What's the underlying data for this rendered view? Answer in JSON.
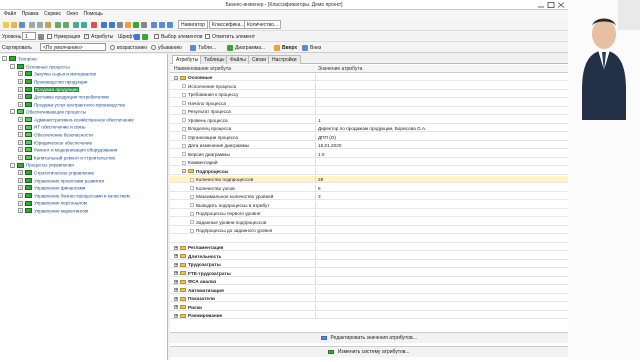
{
  "window": {
    "title": "Бизнес-инженер - [Классификаторы. Демо проект]"
  },
  "menu": [
    "Файл",
    "Правка",
    "Сервис",
    "Окно",
    "Помощь"
  ],
  "toolbar_tabs": [
    "Навигатор",
    "Классифика...",
    "Количество..."
  ],
  "toolbar2": {
    "level_label": "Уровень",
    "level_value": "1",
    "numbering": "Нумерация",
    "attributes": "Атрибуты",
    "font": "Шрифт",
    "select_elements": "Выбор элементов",
    "mark_element": "Отметить элемент"
  },
  "toolbar3": {
    "sort_label": "Сортировать",
    "sort_value": "<По умолчанию>",
    "asc": "возрастанию",
    "desc": "убыванию",
    "table": "Табли...",
    "diagram": "Диаграмма...",
    "up": "Вверх",
    "down": "Вниз"
  },
  "tree": [
    {
      "text": "Техпрокс",
      "level": 0,
      "expand": "-",
      "color": "#3a3"
    },
    {
      "text": "Основные процессы",
      "level": 1,
      "expand": "-",
      "color": "#3a3"
    },
    {
      "text": "Закупка сырья и материалов",
      "level": 2,
      "expand": "+",
      "color": "#3a3"
    },
    {
      "text": "Производство продукции",
      "level": 2,
      "expand": "+",
      "color": "#3a3"
    },
    {
      "text": "Продажа продукции",
      "level": 2,
      "expand": "+",
      "color": "#3a3",
      "selected": true
    },
    {
      "text": "Доставка продукции потребителям",
      "level": 2,
      "expand": "+",
      "color": "#3a3"
    },
    {
      "text": "Продажа услуг контрактного производства",
      "level": 2,
      "expand": "+",
      "color": "#3a3"
    },
    {
      "text": "Обеспечивающие процессы",
      "level": 1,
      "expand": "-",
      "color": "#5c5"
    },
    {
      "text": "Административно-хозяйственное обеспечение",
      "level": 2,
      "expand": "+",
      "color": "#5c5"
    },
    {
      "text": "ИТ обеспечение и связь",
      "level": 2,
      "expand": "+",
      "color": "#5c5"
    },
    {
      "text": "Обеспечение безопасности",
      "level": 2,
      "expand": "+",
      "color": "#5c5"
    },
    {
      "text": "Юридическое обеспечение",
      "level": 2,
      "expand": "+",
      "color": "#5c5"
    },
    {
      "text": "Ремонт и модернизация оборудования",
      "level": 2,
      "expand": "+",
      "color": "#5c5"
    },
    {
      "text": "Капитальный ремонт и строительство",
      "level": 2,
      "expand": "+",
      "color": "#5c5"
    },
    {
      "text": "Процессы управления",
      "level": 1,
      "expand": "-",
      "color": "#3a3"
    },
    {
      "text": "Стратегическое управление",
      "level": 2,
      "expand": "+",
      "color": "#3a3"
    },
    {
      "text": "Управление проектами развития",
      "level": 2,
      "expand": "+",
      "color": "#3a3"
    },
    {
      "text": "Управление финансами",
      "level": 2,
      "expand": "+",
      "color": "#3a3"
    },
    {
      "text": "Управление бизнес-процессами и качеством",
      "level": 2,
      "expand": "+",
      "color": "#3a3"
    },
    {
      "text": "Управление персоналом",
      "level": 2,
      "expand": "+",
      "color": "#3a3"
    },
    {
      "text": "Управление маркетингом",
      "level": 2,
      "expand": "+",
      "color": "#3a3"
    }
  ],
  "tabs": [
    "Атрибуты",
    "Таблицы",
    "Файлы",
    "Связи",
    "Настройки"
  ],
  "columns": {
    "name": "Наименование атрибута",
    "value": "Значение атрибута"
  },
  "rows": [
    {
      "name": "Основные",
      "value": "",
      "type": "group",
      "level": 0,
      "expand": "-"
    },
    {
      "name": "Исполнение процесса",
      "value": "",
      "level": 1
    },
    {
      "name": "Требования к процессу",
      "value": "",
      "level": 1
    },
    {
      "name": "Начало процесса",
      "value": "",
      "level": 1
    },
    {
      "name": "Результат процесса",
      "value": "",
      "level": 1
    },
    {
      "name": "Уровень процесса",
      "value": "1",
      "level": 1
    },
    {
      "name": "Владелец процесса",
      "value": "Директор по продажам продукции, Борисова О.А.",
      "level": 1
    },
    {
      "name": "Организации процесса",
      "value": "ДПП (О)",
      "level": 1
    },
    {
      "name": "Дата изменения диаграммы",
      "value": "15.01.2020",
      "level": 1
    },
    {
      "name": "Версия диаграммы",
      "value": "1.0",
      "level": 1
    },
    {
      "name": "Комментарий",
      "value": "",
      "level": 1
    },
    {
      "name": "Подпроцессы",
      "value": "",
      "type": "group",
      "level": 1,
      "expand": "-"
    },
    {
      "name": "Количество подпроцессов",
      "value": "28",
      "level": 2,
      "highlight": true
    },
    {
      "name": "Количество узлов",
      "value": "6",
      "level": 2
    },
    {
      "name": "Максимальное количество уровней",
      "value": "3",
      "level": 2
    },
    {
      "name": "Выводить подпроцессы в атрибут",
      "value": "",
      "level": 2
    },
    {
      "name": "Подпроцессы первого уровня",
      "value": "",
      "level": 2
    },
    {
      "name": "Заданные уровни подпроцессов",
      "value": "",
      "level": 2
    },
    {
      "name": "Подпроцессы до заданного уровня",
      "value": "",
      "level": 2
    },
    {
      "name": "",
      "value": "",
      "level": 0,
      "blank": true
    },
    {
      "name": "Регламентация",
      "value": "",
      "type": "group",
      "level": 0,
      "expand": "+"
    },
    {
      "name": "Длительность",
      "value": "",
      "type": "group",
      "level": 0,
      "expand": "+"
    },
    {
      "name": "Трудозатраты",
      "value": "",
      "type": "group",
      "level": 0,
      "expand": "+"
    },
    {
      "name": "FTE-трудозатраты",
      "value": "",
      "type": "group",
      "level": 0,
      "expand": "+"
    },
    {
      "name": "ФСА анализ",
      "value": "",
      "type": "group",
      "level": 0,
      "expand": "+"
    },
    {
      "name": "Автоматизация",
      "value": "",
      "type": "group",
      "level": 0,
      "expand": "+"
    },
    {
      "name": "Показатели",
      "value": "",
      "type": "group",
      "level": 0,
      "expand": "+"
    },
    {
      "name": "Риски",
      "value": "",
      "type": "group",
      "level": 0,
      "expand": "+"
    },
    {
      "name": "Ранжирование",
      "value": "",
      "type": "group",
      "level": 0,
      "expand": "+"
    }
  ],
  "buttons": {
    "edit_values": "Редактировать значения атрибутов...",
    "change_system": "Изменить систему атрибутов..."
  },
  "colors": {
    "selected": "#1f8f3a",
    "accent": "#2a8a3a"
  }
}
